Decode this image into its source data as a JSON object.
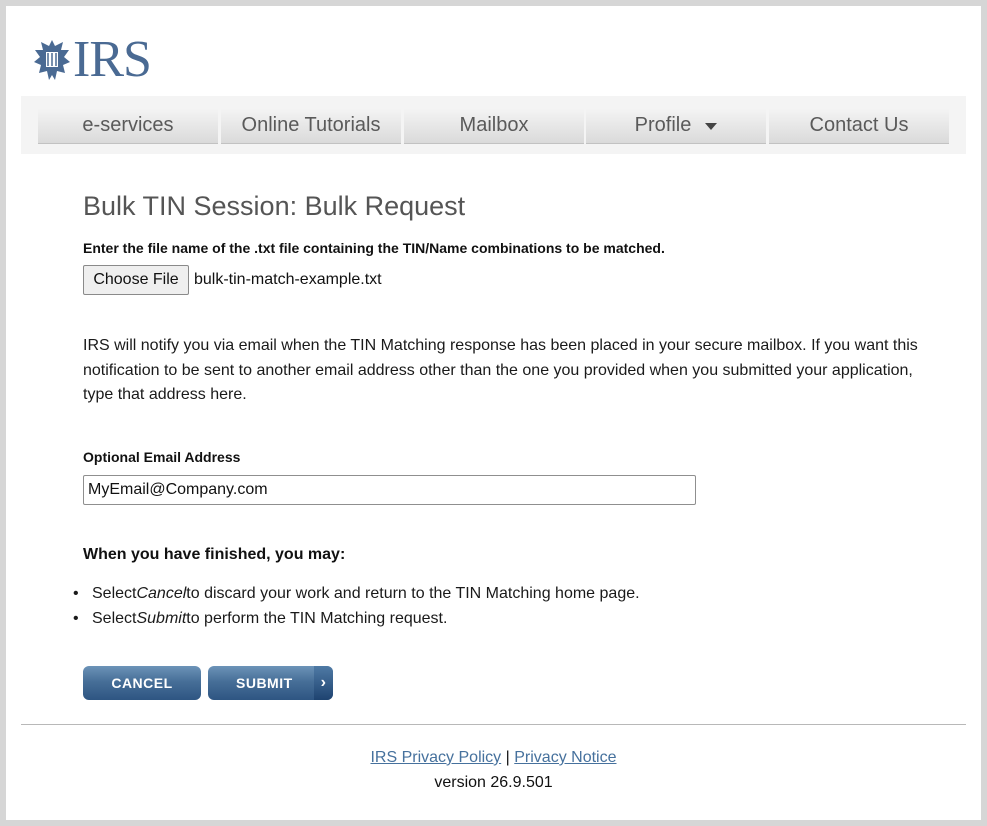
{
  "logo": {
    "text": "IRS",
    "icon": "irs-eagle-logo"
  },
  "nav": {
    "items": [
      {
        "label": "e-services"
      },
      {
        "label": "Online Tutorials"
      },
      {
        "label": "Mailbox"
      },
      {
        "label": "Profile",
        "icon": "caret-down"
      },
      {
        "label": "Contact Us"
      }
    ]
  },
  "page": {
    "title": "Bulk TIN Session: Bulk Request",
    "file_label": "Enter the file name of the .txt file containing the TIN/Name combinations to be matched.",
    "choose_file_label": "Choose File",
    "file_name": "bulk-tin-match-example.txt",
    "notice": "IRS will notify you via email when the TIN Matching response has been placed in your secure mailbox. If you want this notification to be sent to another email address other than the one you provided when you submitted your application, type that address here.",
    "email_label": "Optional Email Address",
    "email_value": "MyEmail@Company.com",
    "finished_heading": "When you have finished, you may:",
    "instructions": [
      {
        "prefix": "Select",
        "action": "Cancel",
        "rest": "to discard your work and return to the TIN Matching home page."
      },
      {
        "prefix": "Select",
        "action": "Submit",
        "rest": "to perform the TIN Matching request."
      }
    ]
  },
  "buttons": {
    "cancel": "CANCEL",
    "submit": "SUBMIT",
    "submit_arrow": "›"
  },
  "footer": {
    "privacy_policy": "IRS Privacy Policy",
    "separator": "|",
    "privacy_notice": "Privacy Notice",
    "version": "version 26.9.501"
  },
  "colors": {
    "brand": "#4a6a93",
    "button": "#476f98",
    "link": "#46719d"
  }
}
